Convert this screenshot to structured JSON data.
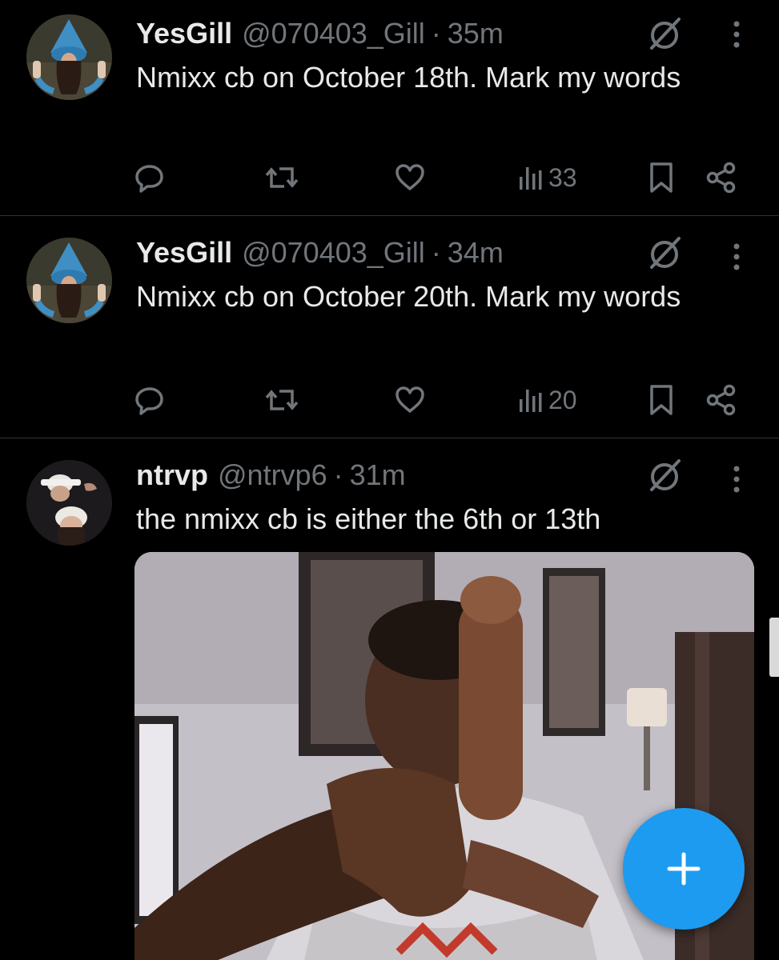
{
  "colors": {
    "background": "#000000",
    "text_primary": "#e7e9ea",
    "text_secondary": "#71767b",
    "divider": "#2f3336",
    "accent": "#1d9bf0"
  },
  "tweets": [
    {
      "name": "YesGill",
      "handle": "@070403_Gill",
      "separator": "·",
      "time": "35m",
      "text": "Nmixx cb on October 18th. Mark my words",
      "views": "33",
      "icons": [
        "grok-icon",
        "more-icon",
        "reply-icon",
        "retweet-icon",
        "like-icon",
        "views-icon",
        "bookmark-icon",
        "share-icon"
      ]
    },
    {
      "name": "YesGill",
      "handle": "@070403_Gill",
      "separator": "·",
      "time": "34m",
      "text": "Nmixx cb on October 20th. Mark my words",
      "views": "20",
      "icons": [
        "grok-icon",
        "more-icon",
        "reply-icon",
        "retweet-icon",
        "like-icon",
        "views-icon",
        "bookmark-icon",
        "share-icon"
      ]
    },
    {
      "name": "ntrvp",
      "handle": "@ntrvp6",
      "separator": "·",
      "time": "31m",
      "text": "the nmixx cb is either the 6th or 13th",
      "media": "image",
      "icons": [
        "grok-icon",
        "more-icon"
      ]
    }
  ],
  "compose_button": {
    "icon": "plus-icon"
  }
}
